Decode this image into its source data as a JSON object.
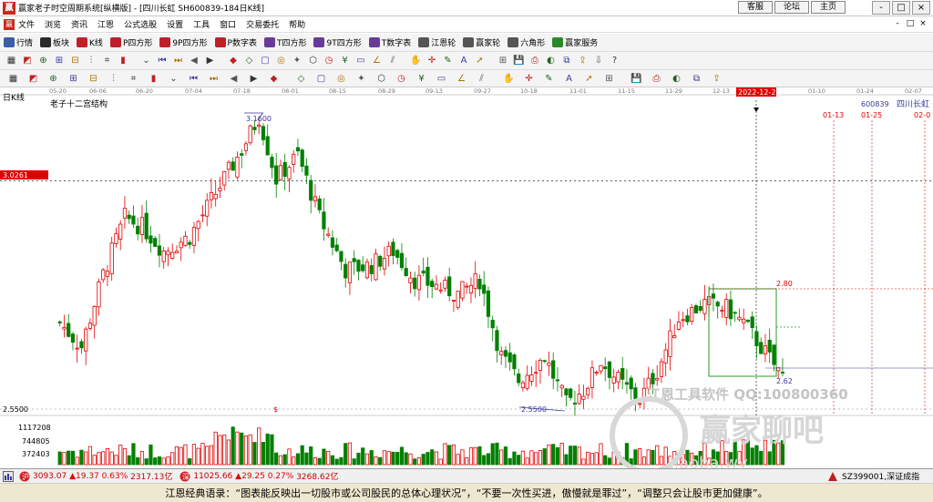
{
  "window": {
    "title": "赢家老子时空周期系统[纵横版] - [四川长虹  SH600839-184日K线]",
    "links": [
      "客服",
      "论坛",
      "主页"
    ],
    "controls": [
      "-",
      "□",
      "×"
    ]
  },
  "menu": [
    "文件",
    "浏览",
    "资讯",
    "江恩",
    "公式选股",
    "设置",
    "工具",
    "窗口",
    "交易委托",
    "帮助"
  ],
  "menu_right": [
    "-",
    "□",
    "×"
  ],
  "toolbar1": [
    {
      "label": "行情",
      "color": "#3a5ea8"
    },
    {
      "label": "板块",
      "color": "#2a2a2a"
    },
    {
      "label": "K线",
      "color": "#c0202a"
    },
    {
      "label": "P四方形",
      "color": "#c0202a"
    },
    {
      "label": "9P四方形",
      "color": "#c0202a"
    },
    {
      "label": "P数字表",
      "color": "#c0202a"
    },
    {
      "label": "T四方形",
      "color": "#6a3a9a"
    },
    {
      "label": "9T四方形",
      "color": "#6a3a9a"
    },
    {
      "label": "T数字表",
      "color": "#6a3a9a"
    },
    {
      "label": "江恩轮",
      "color": "#555555"
    },
    {
      "label": "赢家轮",
      "color": "#555555"
    },
    {
      "label": "六角形",
      "color": "#555555"
    },
    {
      "label": "赢家服务",
      "color": "#2a8a2a"
    }
  ],
  "toolbar2_icons": [
    "layout-icon",
    "wave-icon",
    "add-icon",
    "zoom-in-icon",
    "zoom-out-icon",
    "ruler-icon",
    "grid-icon",
    "bar-icon",
    "chevron-icon",
    "first-icon",
    "last-icon",
    "prev-icon",
    "next-icon",
    "fib-icon",
    "gann-icon",
    "square-icon",
    "cycle-icon",
    "star-icon",
    "hex-icon",
    "time-icon",
    "price-icon",
    "box-icon",
    "angle-icon",
    "channel-icon",
    "hand-icon",
    "cross-icon",
    "pencil-icon",
    "text-icon",
    "arrow-icon",
    "grid2-icon",
    "save-icon",
    "print-icon",
    "color-icon",
    "copy-icon",
    "export-icon",
    "import-icon",
    "help-icon"
  ],
  "toolbar3_icons": [
    "line-icon",
    "ray-icon",
    "segment-icon",
    "hline-icon",
    "vline-icon",
    "parallel-icon",
    "fan-icon",
    "arc-icon",
    "circle-icon",
    "ellipse-icon",
    "spiral-icon",
    "rect-icon",
    "triangle-icon",
    "fib-retrace-icon",
    "fib-time-icon",
    "gann-fan-icon",
    "gann-box-icon",
    "pitchfork-icon",
    "speed-icon",
    "period-icon",
    "cycle-line-icon",
    "wave-line-icon",
    "text-tool-icon",
    "arrow-up-icon",
    "arrow-down-icon",
    "erase-icon",
    "select-icon",
    "undo-icon",
    "redo-icon",
    "copy-tool-icon",
    "paste-icon",
    "delete-icon",
    "lock-icon",
    "color-pick-icon",
    "loop-icon"
  ],
  "chart": {
    "period_label": "日K线",
    "indicator_title": "老子十二宫结构",
    "stock_code": "600839",
    "stock_name": "四川长虹",
    "current_date_box": "2022-12-22",
    "price_box": "3.0261",
    "axis_bottom_price": "2.5500",
    "top_dates": [
      "05-20",
      "06-06",
      "06-20",
      "07-04",
      "07-18",
      "08-01",
      "08-15",
      "08-29",
      "09-13",
      "09-27",
      "10-18",
      "11-01",
      "11-15",
      "11-29",
      "12-13",
      "01-10",
      "01-24",
      "02-07"
    ],
    "future_dates": [
      "01-13",
      "01-25",
      "02-0"
    ],
    "annotations": {
      "high": "3.1600",
      "low": "2.5500",
      "target_top": "2.80",
      "target_bottom": "2.62",
      "marker": "$"
    },
    "volume_ticks": [
      "1117208",
      "744805",
      "372403"
    ],
    "watermark_1": "江恩工具软件  QQ:100800360",
    "watermark_2": "赢家聊吧",
    "watermark_3": "liaoba.wy"
  },
  "chart_data": {
    "type": "candlestick",
    "title": "老子十二宫结构",
    "series_name": "四川长虹 600839",
    "ylim": [
      2.55,
      3.16
    ],
    "levels": {
      "max": 3.16,
      "min": 2.55,
      "marker_line": 3.0261
    }
  },
  "status": {
    "sh_index": "3093.07",
    "sh_change": "▲19.37",
    "sh_pct": "0.63%",
    "sh_amount": "2317.13亿",
    "sz_index": "11025.66",
    "sz_change": "▲29.25",
    "sz_pct": "0.27%",
    "sz_amount": "3268.62亿",
    "right": "SZ399001,深证成指"
  },
  "quote": "江恩经典语录：“图表能反映出一切股市或公司股民的总体心理状况”，“不要一次性买进，傲慢就是罪过”，“调整只会让股市更加健康”。"
}
